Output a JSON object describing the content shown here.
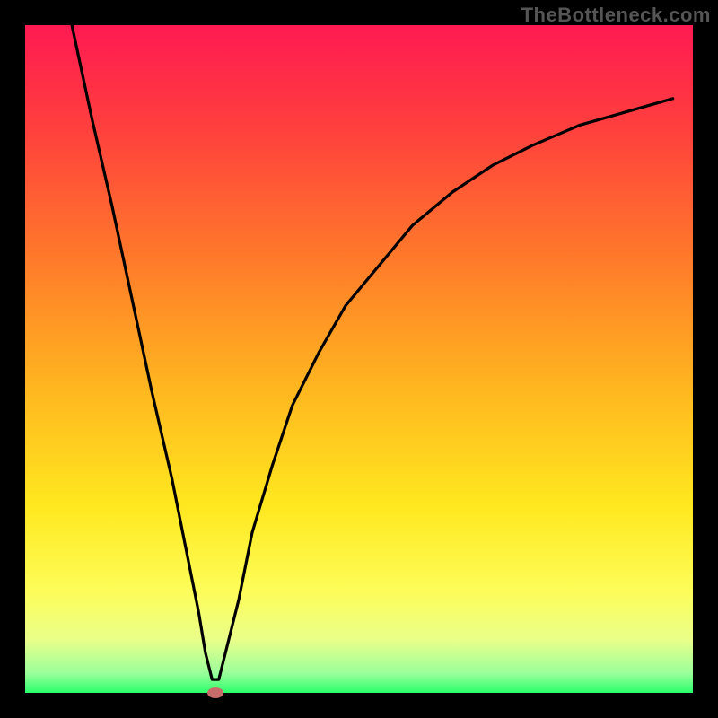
{
  "watermark": "TheBottleneck.com",
  "chart_data": {
    "type": "line",
    "title": "",
    "xlabel": "",
    "ylabel": "",
    "xlim": [
      0,
      100
    ],
    "ylim": [
      0,
      100
    ],
    "grid": false,
    "legend_position": "none",
    "series": [
      {
        "name": "bottleneck-curve",
        "x": [
          7,
          10,
          13,
          16,
          19,
          22,
          24,
          26,
          27,
          28,
          29,
          30,
          32,
          34,
          37,
          40,
          44,
          48,
          53,
          58,
          64,
          70,
          76,
          83,
          90,
          97
        ],
        "y": [
          100,
          86,
          73,
          59,
          45,
          32,
          22,
          12,
          6,
          2,
          2,
          6,
          14,
          24,
          34,
          43,
          51,
          58,
          64,
          70,
          75,
          79,
          82,
          85,
          87,
          89
        ]
      }
    ],
    "marker": {
      "name": "optimal-point",
      "x": 28.5,
      "y": 0,
      "color": "#c86b6b",
      "rx": 9,
      "ry": 6
    },
    "gradient_stops": [
      {
        "offset": 0.0,
        "color": "#ff1a52"
      },
      {
        "offset": 0.15,
        "color": "#ff3e3e"
      },
      {
        "offset": 0.35,
        "color": "#ff7a2a"
      },
      {
        "offset": 0.55,
        "color": "#ffb81f"
      },
      {
        "offset": 0.72,
        "color": "#ffe81f"
      },
      {
        "offset": 0.85,
        "color": "#fdfd5a"
      },
      {
        "offset": 0.92,
        "color": "#eaff8a"
      },
      {
        "offset": 0.97,
        "color": "#9bff9b"
      },
      {
        "offset": 1.0,
        "color": "#2bff6a"
      }
    ],
    "frame": {
      "outer_width": 800,
      "outer_height": 800,
      "border_width": 28,
      "border_color": "#000000"
    }
  }
}
